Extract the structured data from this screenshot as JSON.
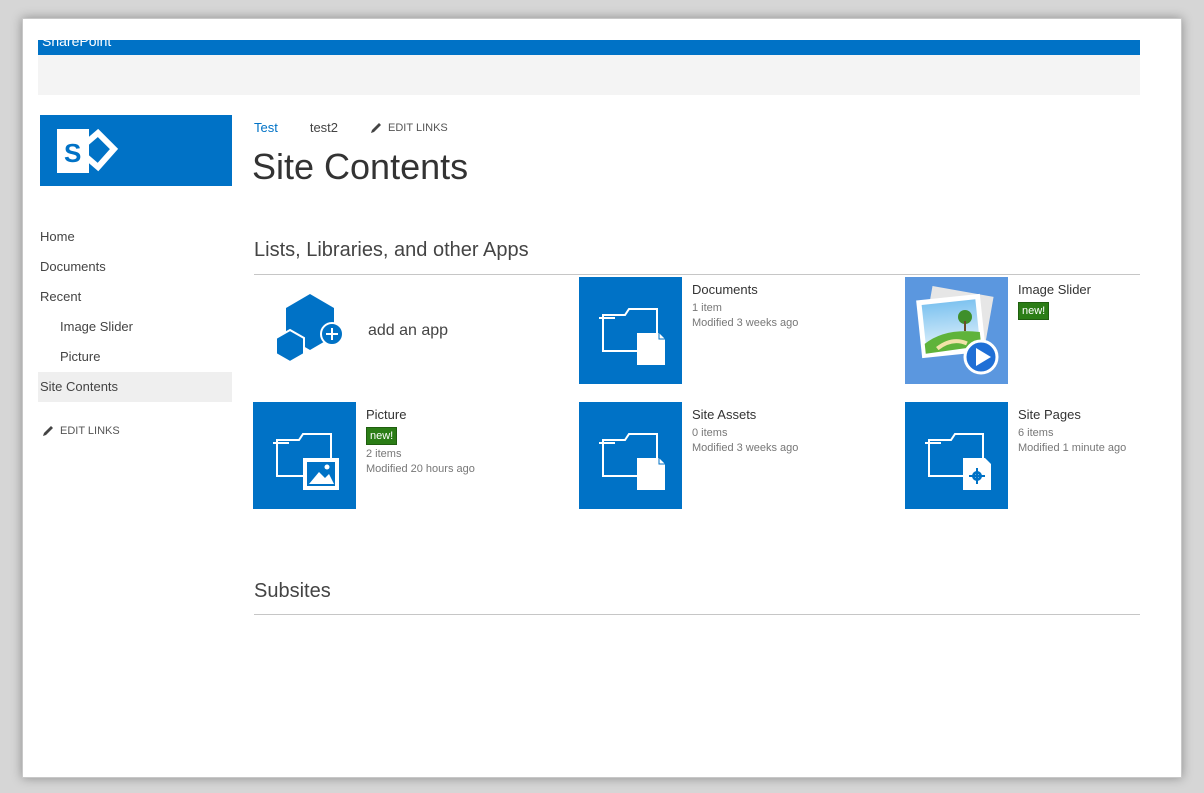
{
  "suitebar": {
    "brand": "SharePoint"
  },
  "leftnav": {
    "items": [
      {
        "label": "Home"
      },
      {
        "label": "Documents"
      },
      {
        "label": "Recent"
      },
      {
        "label": "Image Slider"
      },
      {
        "label": "Picture"
      },
      {
        "label": "Site Contents"
      }
    ],
    "edit_links": "EDIT LINKS"
  },
  "topnav": {
    "items": [
      {
        "label": "Test"
      },
      {
        "label": "test2"
      }
    ],
    "edit_links": "EDIT LINKS"
  },
  "page": {
    "title": "Site Contents",
    "apps_section": "Lists, Libraries, and other Apps",
    "subsites_section": "Subsites"
  },
  "add_app": {
    "label": "add an app"
  },
  "apps": [
    {
      "name": "Documents",
      "count": "1 item",
      "modified": "Modified 3 weeks ago"
    },
    {
      "name": "Image Slider",
      "badge": "new!"
    },
    {
      "name": "Picture",
      "badge": "new!",
      "count": "2 items",
      "modified": "Modified 20 hours ago"
    },
    {
      "name": "Site Assets",
      "count": "0 items",
      "modified": "Modified 3 weeks ago"
    },
    {
      "name": "Site Pages",
      "count": "6 items",
      "modified": "Modified 1 minute ago"
    }
  ],
  "colors": {
    "brand": "#0072c6",
    "badge": "#2b7d16"
  }
}
